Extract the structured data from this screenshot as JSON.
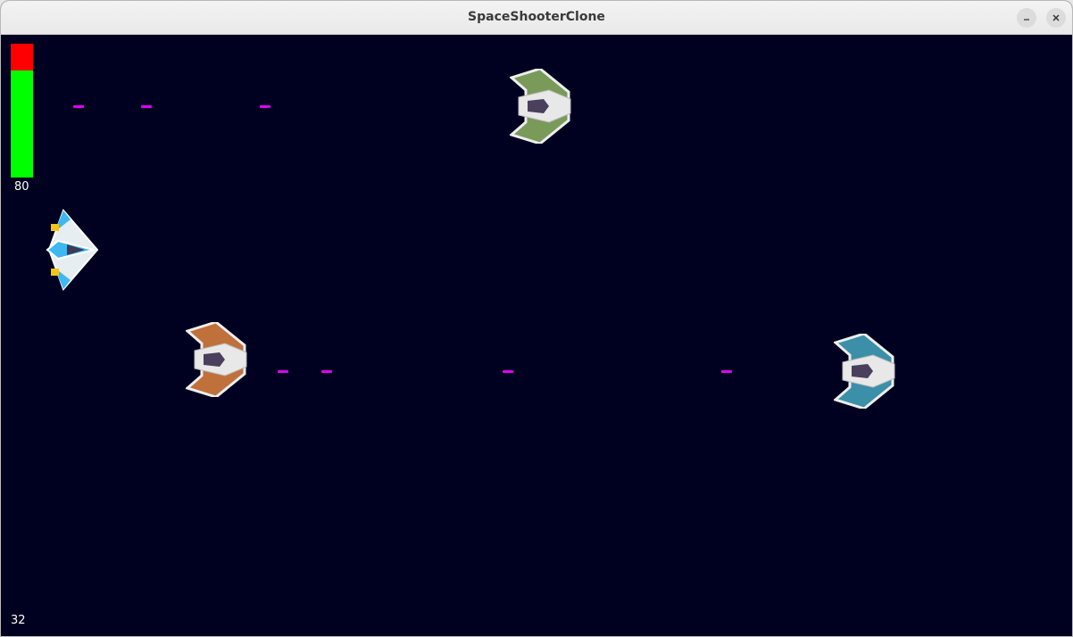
{
  "window": {
    "title": "SpaceShooterClone"
  },
  "hud": {
    "health_value": "80",
    "health_fraction": 0.8,
    "score": "32",
    "bar_color_full": "#00ff00",
    "bar_color_empty": "#ff0000"
  },
  "player": {
    "icon": "player-spaceship-icon",
    "color": "#3fb8f0"
  },
  "enemies": [
    {
      "icon": "enemy-ship-icon",
      "color": "#7a9a5a"
    },
    {
      "icon": "enemy-ship-icon",
      "color": "#c0703a"
    },
    {
      "icon": "enemy-ship-icon",
      "color": "#3b8fa8"
    }
  ],
  "bullet_color": "#e000ff",
  "background_color": "#000020"
}
